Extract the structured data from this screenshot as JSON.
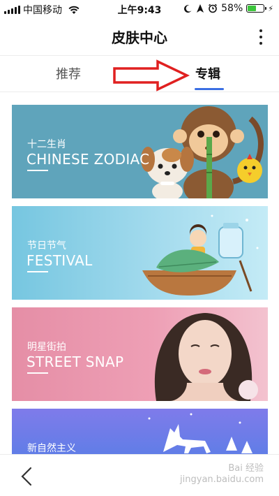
{
  "status_bar": {
    "carrier": "中国移动",
    "time": "上午9:43",
    "battery_percent": "58%",
    "battery_level": 0.58,
    "icons": [
      "signal-icon",
      "wifi-icon",
      "moon-icon",
      "alarm-icon",
      "battery-icon"
    ]
  },
  "nav": {
    "title": "皮肤中心",
    "more_icon": "more-vertical-icon"
  },
  "tabs": [
    {
      "label": "推荐",
      "active": false
    },
    {
      "label": "专辑",
      "active": true
    }
  ],
  "accent_color": "#3b6fe3",
  "banners": [
    {
      "title_cn": "十二生肖",
      "title_en": "CHINESE ZODIAC",
      "bg": "#5fa4bb"
    },
    {
      "title_cn": "节日节气",
      "title_en": "FESTIVAL",
      "bg": "#76c6e0"
    },
    {
      "title_cn": "明星街拍",
      "title_en": "STREET SNAP",
      "bg": "#e58ea6"
    },
    {
      "title_cn": "新自然主义",
      "title_en": "",
      "bg": "#7f7bea"
    }
  ],
  "bottom": {
    "back_icon": "chevron-left-icon",
    "watermark_line1": "Bai 经验",
    "watermark_line2": "jingyan.baidu.com"
  }
}
